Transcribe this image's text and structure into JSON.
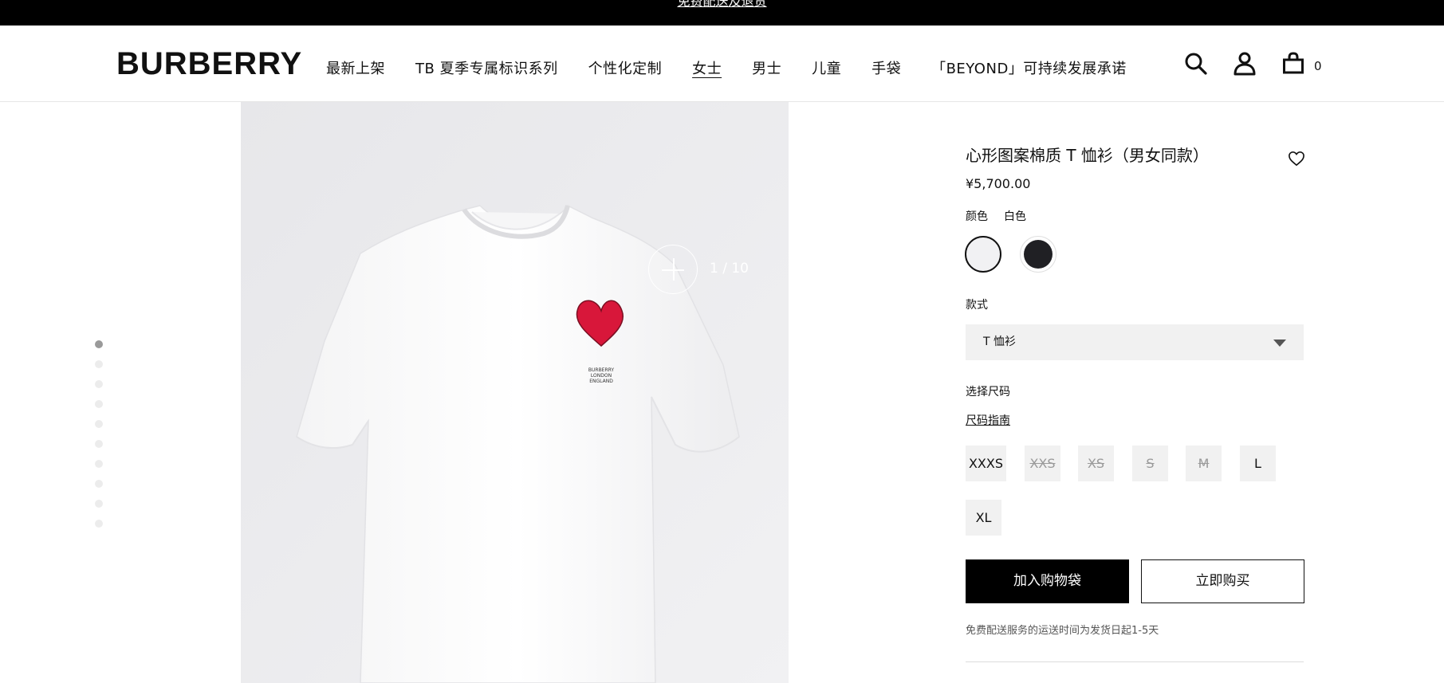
{
  "announcement": {
    "text": "免费配送及退货"
  },
  "header": {
    "logo": "BURBERRY",
    "nav": [
      {
        "label": "最新上架"
      },
      {
        "label": "TB 夏季专属标识系列"
      },
      {
        "label": "个性化定制"
      },
      {
        "label": "女士",
        "active": true
      },
      {
        "label": "男士"
      },
      {
        "label": "儿童"
      },
      {
        "label": "手袋"
      },
      {
        "label": "「BEYOND」可持续发展承诺"
      }
    ],
    "icons": [
      "search-icon",
      "account-icon",
      "shopping-bag-icon"
    ],
    "cart_count": "0"
  },
  "gallery": {
    "total_images": 10,
    "active_index": 1,
    "counter": "1 / 10",
    "print_text": [
      "BURBERRY",
      "LONDON",
      "ENGLAND"
    ]
  },
  "product": {
    "title": "心形图案棉质 T 恤衫（男女同款）",
    "price": "¥5,700.00",
    "color_label": "颜色",
    "color_value": "白色",
    "colors": [
      {
        "name": "white",
        "hex": "#f1f1f3",
        "selected": true
      },
      {
        "name": "black",
        "hex": "#202024",
        "selected": false
      }
    ],
    "style_label": "款式",
    "style_value": "T 恤衫",
    "size_label": "选择尺码",
    "size_guide": "尺码指南",
    "sizes": [
      {
        "label": "XXXS",
        "available": true
      },
      {
        "label": "XXS",
        "available": false
      },
      {
        "label": "XS",
        "available": false
      },
      {
        "label": "S",
        "available": false
      },
      {
        "label": "M",
        "available": false
      },
      {
        "label": "L",
        "available": true
      },
      {
        "label": "XL",
        "available": true
      }
    ],
    "add_to_bag": "加入购物袋",
    "buy_now": "立即购买",
    "delivery_note": "免费配送服务的运送时间为发货日起1-5天"
  },
  "colors": {
    "brand_black": "#000000",
    "heart_red": "#d8173a",
    "image_bg": "#ececee",
    "chip_bg": "#f1f1f1"
  }
}
